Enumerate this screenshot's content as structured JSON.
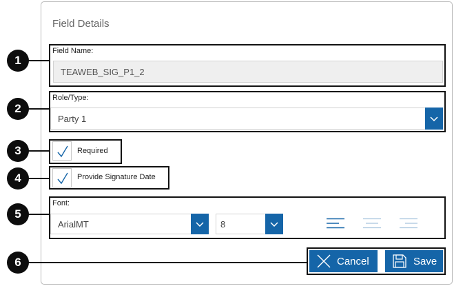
{
  "dialog": {
    "title": "Field Details"
  },
  "callouts": [
    "1",
    "2",
    "3",
    "4",
    "5",
    "6"
  ],
  "field_name": {
    "label": "Field Name:",
    "value": "TEAWEB_SIG_P1_2"
  },
  "role_type": {
    "label": "Role/Type:",
    "value": "Party 1"
  },
  "required": {
    "label": "Required",
    "checked": true
  },
  "signature_date": {
    "label": "Provide Signature Date",
    "checked": true
  },
  "font": {
    "label": "Font:",
    "family": "ArialMT",
    "size": "8",
    "align_icons": [
      "align-left-icon",
      "align-center-icon",
      "align-right-icon"
    ]
  },
  "actions": {
    "cancel_label": "Cancel",
    "save_label": "Save",
    "cancel_icon": "close-icon",
    "save_icon": "save-icon"
  },
  "colors": {
    "accent": "#1565a8",
    "callout": "#0d0d0d",
    "readonly_bg": "#efefef"
  }
}
